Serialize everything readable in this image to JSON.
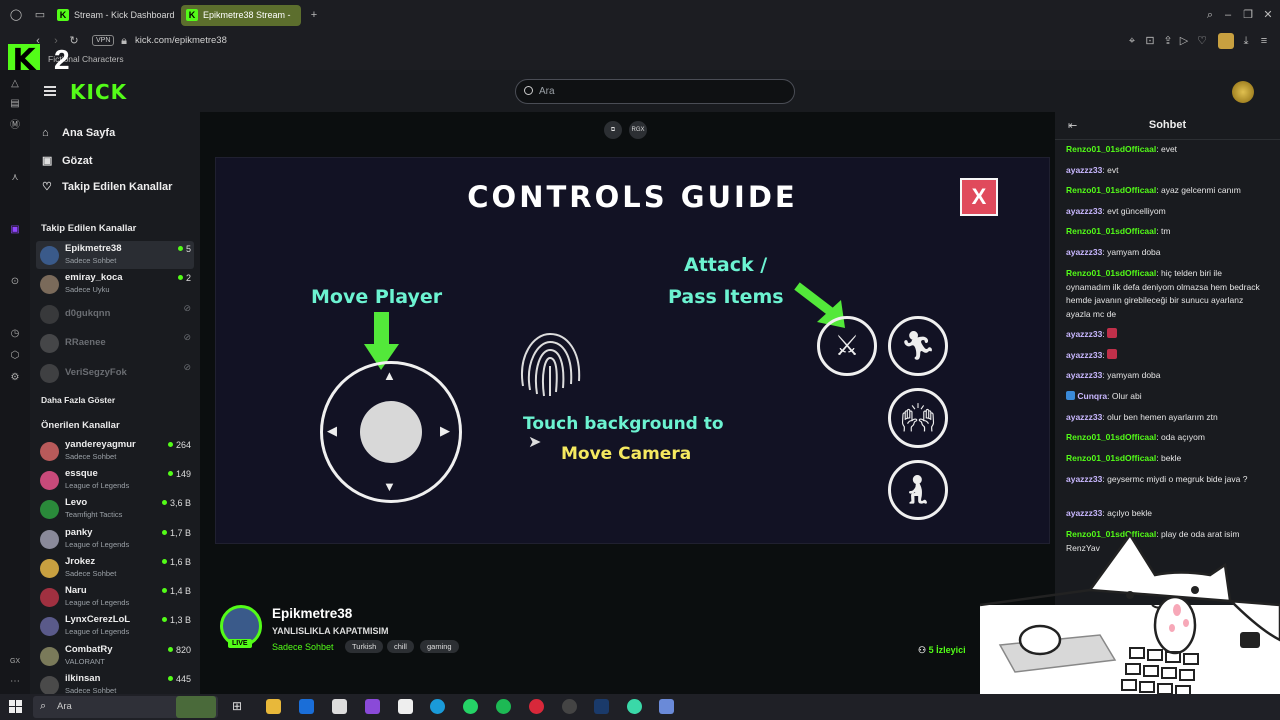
{
  "browser": {
    "tabs": [
      {
        "label": "Stream - Kick Dashboard"
      },
      {
        "label": "Epikmetre38 Stream -"
      }
    ],
    "url": "kick.com/epikmetre38",
    "vpn_label": "VPN",
    "bookmark": "Fictional Characters",
    "overlay_number": "2"
  },
  "header": {
    "logo": "KICK",
    "search_placeholder": "Ara"
  },
  "sidebar": {
    "nav": [
      {
        "label": "Ana Sayfa",
        "icon": "home-icon"
      },
      {
        "label": "Gözat",
        "icon": "browse-icon"
      },
      {
        "label": "Takip Edilen Kanallar",
        "icon": "heart-icon"
      }
    ],
    "followed_title": "Takip Edilen Kanallar",
    "followed": [
      {
        "name": "Epikmetre38",
        "sub": "Sadece Sohbet",
        "viewers": "5",
        "color": "#3a5a8a"
      },
      {
        "name": "emiray_koca",
        "sub": "Sadece Uyku",
        "viewers": "2",
        "color": "#7a6a5a"
      },
      {
        "name": "d0gukqnn",
        "color": "#666"
      },
      {
        "name": "RRaenee",
        "color": "#888"
      },
      {
        "name": "VeriSegzyFok",
        "color": "#777"
      }
    ],
    "show_more": "Daha Fazla Göster",
    "recommended_title": "Önerilen Kanallar",
    "recommended": [
      {
        "name": "yandereyagmur",
        "sub": "Sadece Sohbet",
        "viewers": "264",
        "color": "#b85a5a"
      },
      {
        "name": "essque",
        "sub": "League of Legends",
        "viewers": "149",
        "color": "#c84a7a"
      },
      {
        "name": "Levo",
        "sub": "Teamfight Tactics",
        "viewers": "3,6 B",
        "color": "#2a8a3a"
      },
      {
        "name": "panky",
        "sub": "League of Legends",
        "viewers": "1,7 B",
        "color": "#8a8a9a"
      },
      {
        "name": "Jrokez",
        "sub": "Sadece Sohbet",
        "viewers": "1,6 B",
        "color": "#c8a040"
      },
      {
        "name": "Naru",
        "sub": "League of Legends",
        "viewers": "1,4 B",
        "color": "#a03040"
      },
      {
        "name": "LynxCerezLoL",
        "sub": "League of Legends",
        "viewers": "1,3 B",
        "color": "#5a5a8a"
      },
      {
        "name": "CombatRy",
        "sub": "VALORANT",
        "viewers": "820",
        "color": "#7a7a5a"
      },
      {
        "name": "ilkinsan",
        "sub": "Sadece Sohbet",
        "viewers": "445",
        "color": "#4a4a4a"
      }
    ]
  },
  "game": {
    "top_buttons": [
      "",
      "RGX"
    ],
    "title": "CONTROLS GUIDE",
    "close": "X",
    "move_player": "Move Player",
    "attack_line1": "Attack /",
    "attack_line2": "Pass Items",
    "touch_line1": "Touch background to",
    "touch_line2": "Move Camera"
  },
  "stream": {
    "name": "Epikmetre38",
    "title": "YANLISLIKLA KAPATMISIM",
    "category": "Sadece Sohbet",
    "tags": [
      "Turkish",
      "chill",
      "gaming"
    ],
    "live": "LIVE",
    "viewers_count": "5",
    "viewers_label": "İzleyici"
  },
  "chat": {
    "title": "Sohbet",
    "messages": [
      {
        "user": "Renzo01_01sdOfficaal",
        "text": "evet",
        "color": "#53fc18"
      },
      {
        "user": "ayazzz33",
        "text": "evt",
        "color": "#c9b8ff"
      },
      {
        "user": "Renzo01_01sdOfficaal",
        "text": "ayaz gelcenmi canım",
        "color": "#53fc18"
      },
      {
        "user": "ayazzz33",
        "text": "evt güncelliyom",
        "color": "#c9b8ff"
      },
      {
        "user": "Renzo01_01sdOfficaal",
        "text": "tm",
        "color": "#53fc18"
      },
      {
        "user": "ayazzz33",
        "text": "yamyam doba",
        "color": "#c9b8ff"
      },
      {
        "user": "Renzo01_01sdOfficaal",
        "text": "hiç telden biri ile oynamadım ilk defa deniyom olmazsa hem bedrack hemde javanın girebileceği bir sunucu ayarlanz ayazla mc de",
        "color": "#53fc18"
      },
      {
        "user": "ayazzz33",
        "text": "",
        "color": "#c9b8ff"
      },
      {
        "user": "ayazzz33",
        "text": "",
        "color": "#c9b8ff"
      },
      {
        "user": "ayazzz33",
        "text": "yamyam doba",
        "color": "#c9b8ff"
      },
      {
        "user": "Cunqra",
        "text": "Olur abi",
        "color": "#c9b8ff"
      },
      {
        "user": "ayazzz33",
        "text": "olur ben hemen ayarlarım ztn",
        "color": "#c9b8ff"
      },
      {
        "user": "Renzo01_01sdOfficaal",
        "text": "oda açıyom",
        "color": "#53fc18"
      },
      {
        "user": "Renzo01_01sdOfficaal",
        "text": "bekle",
        "color": "#53fc18"
      },
      {
        "user": "ayazzz33",
        "text": "geysermc miydi o megruk bide java ?",
        "color": "#c9b8ff"
      },
      {
        "user": "ayazzz33",
        "text": "açılyo bekle",
        "color": "#c9b8ff"
      },
      {
        "user": "Renzo01_01sdOfficaal",
        "text": "play de oda arat isim RenzYav",
        "color": "#53fc18"
      }
    ]
  },
  "taskbar": {
    "search": "Ara"
  }
}
